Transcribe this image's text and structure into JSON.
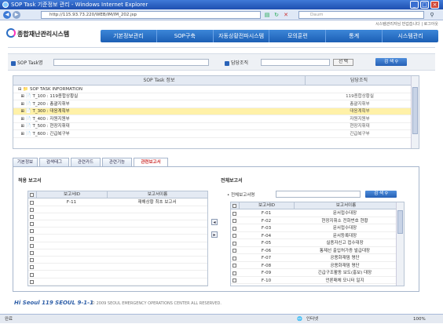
{
  "window": {
    "title": "SOP Task 기준정보 관리 - Windows Internet Explorer"
  },
  "browser": {
    "url": "http://115.93.73.220/WEB/IM/IM_202.jsp",
    "search_placeholder": "Daum"
  },
  "header": {
    "top_links": "시스템관리자님 반갑습니다 | 로그아웃",
    "logo": "종합재난관리시스템",
    "nav": [
      "기본정보관리",
      "SOP구축",
      "자동상황전파시스템",
      "모의훈련",
      "통계",
      "시스템관리"
    ]
  },
  "search": {
    "sop_label": "SOP Task명",
    "dept_label": "담당조직",
    "select_label": "선 택",
    "search_label": "검 색"
  },
  "task_grid": {
    "headers": [
      "SOP Task 정보",
      "담당조직"
    ],
    "root": "SOP TASK INFORMATION",
    "rows": [
      {
        "task": "T_100 : 119종합상황실",
        "dept": "119종합상황실",
        "selected": false
      },
      {
        "task": "T_200 : 총괄지휘부",
        "dept": "총괄지휘부",
        "selected": false
      },
      {
        "task": "T_300 : 대응계획부",
        "dept": "대응계획부",
        "selected": true
      },
      {
        "task": "T_400 : 자원지원부",
        "dept": "자원지원부",
        "selected": false
      },
      {
        "task": "T_500 : 현장지휘대",
        "dept": "현장지휘대",
        "selected": false
      },
      {
        "task": "T_600 : 긴급복구부",
        "dept": "긴급복구부",
        "selected": false
      }
    ]
  },
  "tabs": [
    {
      "label": "기본정보",
      "active": false
    },
    {
      "label": "검색태그",
      "active": false
    },
    {
      "label": "관련카드",
      "active": false
    },
    {
      "label": "관련기능",
      "active": false
    },
    {
      "label": "관련보고서",
      "active": true
    }
  ],
  "applied": {
    "title": "적용 보고서",
    "headers": [
      "보고서ID",
      "보고서이름"
    ],
    "rows": [
      {
        "id": "F-11",
        "name": "재해상황 최초 보고서"
      }
    ]
  },
  "all_reports": {
    "title": "전체보고서",
    "name_label": "전체보고서명",
    "search_label": "검 색",
    "headers": [
      "보고서ID",
      "보고서이름"
    ],
    "rows": [
      {
        "id": "F-01",
        "name": "문서접수대장"
      },
      {
        "id": "F-02",
        "name": "현장지휘소 전화번호 현황"
      },
      {
        "id": "F-03",
        "name": "문서접수대장"
      },
      {
        "id": "F-04",
        "name": "문서등록대장"
      },
      {
        "id": "F-05",
        "name": "실종자신고 접수대장"
      },
      {
        "id": "F-06",
        "name": "통제선 출입허가증 발급대장"
      },
      {
        "id": "F-07",
        "name": "공용화재댐 명단"
      },
      {
        "id": "F-08",
        "name": "공용화재댐 명단"
      },
      {
        "id": "F-09",
        "name": "긴급구조활동 보도(홍보) 대장"
      },
      {
        "id": "F-10",
        "name": "언론매체 모니터 일지"
      }
    ]
  },
  "footer": {
    "brand": "Hi Seoul 119 SEOUL 9-1-1",
    "copyright": "© 2009 SEOUL EMERGENCY OPERATIONS CENTER ALL RESERVED."
  },
  "statusbar": {
    "left": "완료",
    "zone": "인터넷",
    "zoom": "100%"
  }
}
